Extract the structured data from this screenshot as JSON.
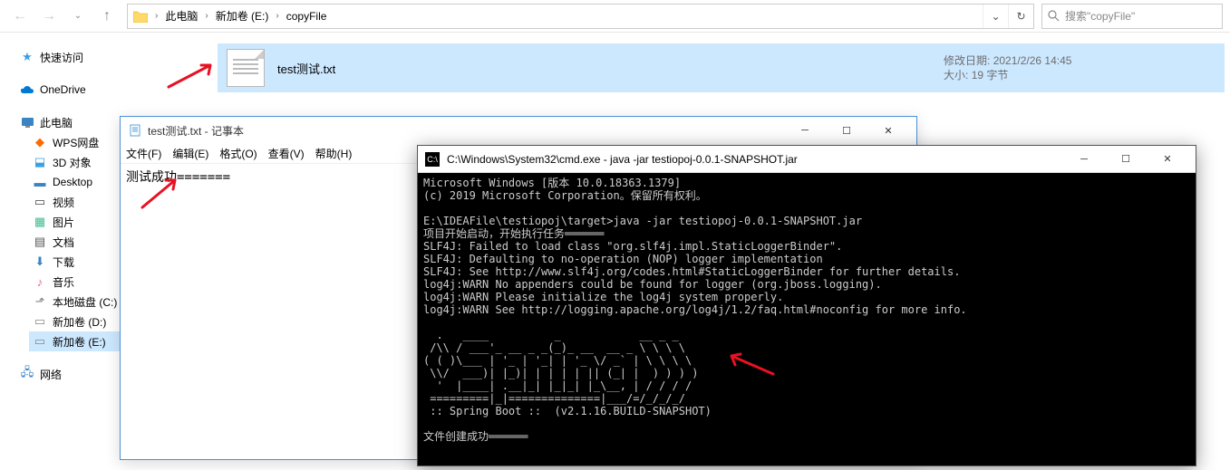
{
  "nav": {
    "crumbs": [
      "此电脑",
      "新加卷 (E:)",
      "copyFile"
    ],
    "search_placeholder": "搜索\"copyFile\""
  },
  "sidebar": {
    "quick": "快速访问",
    "onedrive": "OneDrive",
    "thispc": "此电脑",
    "items": [
      "WPS网盘",
      "3D 对象",
      "Desktop",
      "视频",
      "图片",
      "文档",
      "下载",
      "音乐",
      "本地磁盘 (C:)",
      "新加卷 (D:)",
      "新加卷 (E:)"
    ],
    "network": "网络"
  },
  "file": {
    "name": "test测试.txt",
    "meta_date_label": "修改日期:",
    "meta_date": "2021/2/26 14:45",
    "meta_size_label": "大小:",
    "meta_size": "19 字节"
  },
  "notepad": {
    "title": "test测试.txt - 记事本",
    "menu": [
      "文件(F)",
      "编辑(E)",
      "格式(O)",
      "查看(V)",
      "帮助(H)"
    ],
    "content": "测试成功======="
  },
  "cmd": {
    "title": "C:\\Windows\\System32\\cmd.exe - java  -jar testiopoj-0.0.1-SNAPSHOT.jar",
    "lines": "Microsoft Windows [版本 10.0.18363.1379]\n(c) 2019 Microsoft Corporation。保留所有权利。\n\nE:\\IDEAFile\\testiopoj\\target>java -jar testiopoj-0.0.1-SNAPSHOT.jar\n项目开始启动，开始执行任务══════\nSLF4J: Failed to load class \"org.slf4j.impl.StaticLoggerBinder\".\nSLF4J: Defaulting to no-operation (NOP) logger implementation\nSLF4J: See http://www.slf4j.org/codes.html#StaticLoggerBinder for further details.\nlog4j:WARN No appenders could be found for logger (org.jboss.logging).\nlog4j:WARN Please initialize the log4j system properly.\nlog4j:WARN See http://logging.apache.org/log4j/1.2/faq.html#noconfig for more info.\n\n  .   ____          _            __ _ _\n /\\\\ / ___'_ __ _ _(_)_ __  __ _ \\ \\ \\ \\\n( ( )\\___ | '_ | '_| | '_ \\/ _` | \\ \\ \\ \\\n \\\\/  ___)| |_)| | | | | || (_| |  ) ) ) )\n  '  |____| .__|_| |_|_| |_\\__, | / / / /\n =========|_|==============|___/=/_/_/_/\n :: Spring Boot ::  (v2.1.16.BUILD-SNAPSHOT)\n\n文件创建成功══════"
  }
}
